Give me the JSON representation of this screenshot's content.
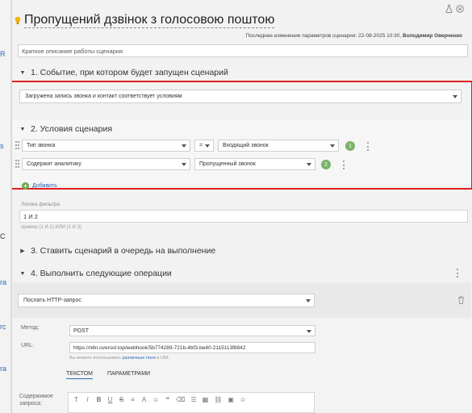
{
  "backdrop": {
    "fragments": [
      ":",
      ":",
      "R",
      "s",
      "C",
      "ra",
      "rc",
      "ra"
    ]
  },
  "header": {
    "title": "Пропущений дзвінок з голосовою поштою",
    "last_modified_prefix": "Последнее изменение параметров сценария: 22-08-2025 10:30,",
    "last_modified_user": "Володимир Оверченко"
  },
  "description": {
    "placeholder": "Краткое описание работы сценария"
  },
  "section1": {
    "label": "1. Событие, при котором будет запущен сценарий",
    "event_value": "Загружена запись звонка и контакт соответствует условиям"
  },
  "section2": {
    "label": "2. Условия сценария",
    "conditions": [
      {
        "field": "Тип звонка",
        "operator": "=",
        "value": "Входящий звонок",
        "index": "1"
      },
      {
        "field": "Содержит аналитику",
        "operator": "",
        "value": "Пропущенный звонок",
        "index": "2"
      }
    ],
    "add_label": "Добавить",
    "filter_label": "Логика фильтра",
    "filter_value": "1 И 2",
    "filter_hint": "пример (1 И 2) ИЛИ (1 И 3)"
  },
  "section3": {
    "label": "3. Ставить сценарий в очередь на выполнение"
  },
  "section4": {
    "label": "4. Выполнить следующие операции",
    "operation": "Послать HTTP-запрос",
    "method_label": "Метод:",
    "method_value": "POST",
    "url_label": "URL:",
    "url_value": "https://n8n.oversol.top/webhook/5b774289-721b-4bf3-be40-2115113f8842",
    "url_hint_prefix": "Вы можете использовать",
    "url_hint_link": "различные поля",
    "url_hint_suffix": "в URL",
    "tabs": [
      "ТЕКСТОМ",
      "ПАРАМЕТРАМИ"
    ],
    "body_label_line1": "Содержимое",
    "body_label_line2": "запроса:"
  },
  "toolbar_icons": [
    "text-style-icon",
    "italic-icon",
    "bold-icon",
    "underline-icon",
    "strikethrough-icon",
    "align-icon",
    "font-color-icon",
    "emoji-icon",
    "quote-icon",
    "eraser-icon",
    "list-icon",
    "table-icon",
    "link-icon",
    "image-icon",
    "smile-icon"
  ],
  "toolbar_glyphs": [
    "T",
    "I",
    "B",
    "U",
    "S",
    "≡",
    "A",
    "☺",
    "❝",
    "⌫",
    "☰",
    "▦",
    "⛓",
    "▣",
    "☺"
  ],
  "colors": {
    "highlight_border": "#e02020",
    "badge": "#7ab26a",
    "link": "#2a6ab7"
  }
}
